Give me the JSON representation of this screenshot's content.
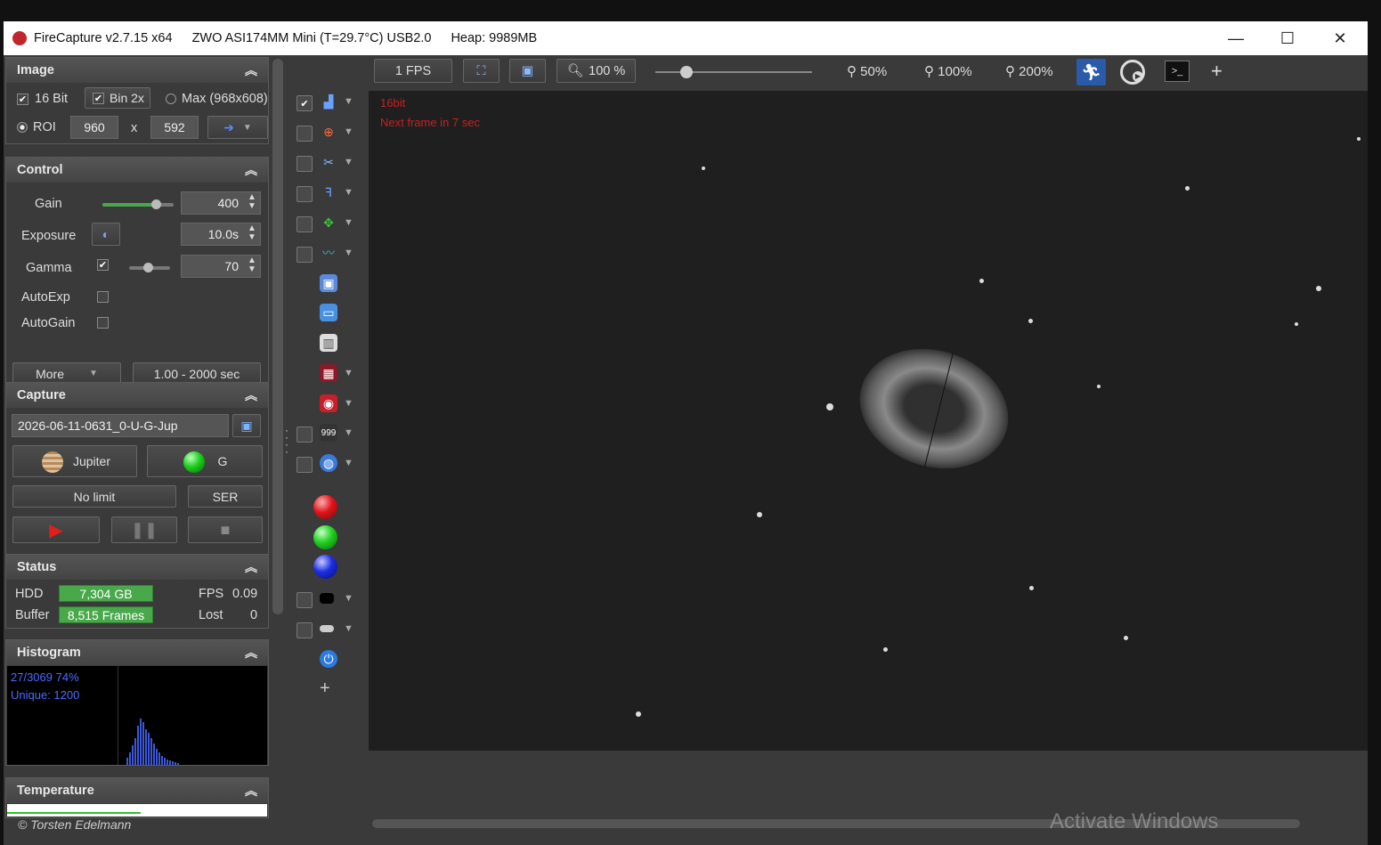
{
  "titlebar": {
    "app": "FireCapture v2.7.15 x64",
    "camera": "ZWO ASI174MM Mini (T=29.7°C) USB2.0",
    "heap": "Heap: 9989MB",
    "min": "—",
    "max": "☐",
    "close": "✕"
  },
  "image": {
    "title": "Image",
    "bit16": "16 Bit",
    "bin": "Bin 2x",
    "max": "Max (968x608)",
    "roi": "ROI",
    "roi_w": "960",
    "roi_x": "x",
    "roi_h": "592"
  },
  "control": {
    "title": "Control",
    "gain_label": "Gain",
    "gain_value": "400",
    "gain_level": 0.75,
    "exposure_label": "Exposure",
    "exposure_value": "10.0s",
    "gamma_label": "Gamma",
    "gamma_value": "70",
    "gamma_level": 0.45,
    "autoexp": "AutoExp",
    "autogain": "AutoGain",
    "more": "More",
    "range": "1.00 - 2000 sec"
  },
  "capture": {
    "title": "Capture",
    "filename": "2026-06-11-0631_0-U-G-Jup",
    "object": "Jupiter",
    "filter": "G",
    "limit": "No limit",
    "format": "SER"
  },
  "status": {
    "title": "Status",
    "hdd_label": "HDD",
    "hdd_value": "7,304 GB",
    "fps_label": "FPS",
    "fps_value": "0.09",
    "buffer_label": "Buffer",
    "buffer_value": "8,515 Frames",
    "lost_label": "Lost",
    "lost_value": "0"
  },
  "histogram": {
    "title": "Histogram",
    "line1": "27/3069 74%",
    "line2": "Unique: 1200"
  },
  "temperature": {
    "title": "Temperature"
  },
  "footer": {
    "copyright": "© Torsten Edelmann"
  },
  "toolbar": {
    "fps": "1 FPS",
    "zoom": "100 %",
    "z50": "50%",
    "z100": "100%",
    "z200": "200%",
    "plus": "+",
    "zoom_level": 0.2
  },
  "overlay": {
    "bit": "16bit",
    "next": "Next frame in 7 sec"
  },
  "watermark": "Activate Windows",
  "colors": {
    "accent": "#48a84a",
    "overlay_text": "#c8201f",
    "histogram_bars": "#3b57d9"
  }
}
